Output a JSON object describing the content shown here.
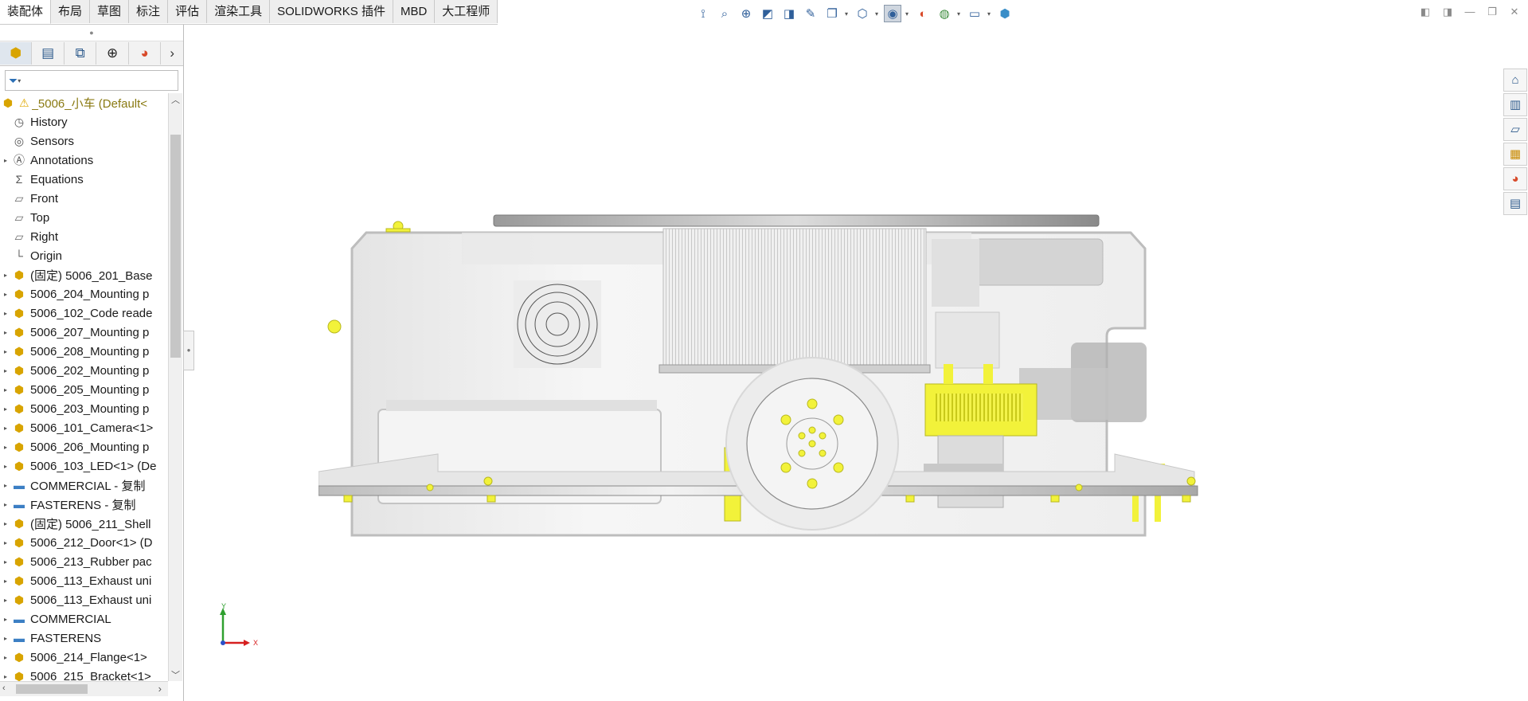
{
  "tabs": [
    {
      "label": "装配体",
      "active": true
    },
    {
      "label": "布局"
    },
    {
      "label": "草图"
    },
    {
      "label": "标注"
    },
    {
      "label": "评估"
    },
    {
      "label": "渲染工具"
    },
    {
      "label": "SOLIDWORKS 插件"
    },
    {
      "label": "MBD"
    },
    {
      "label": "大工程师"
    }
  ],
  "hud_icons": [
    "previous-view-icon",
    "zoom-to-fit-icon",
    "zoom-to-area-icon",
    "section-view-icon",
    "dynamic-annotation-icon",
    "view-orientation-icon",
    "display-style-icon",
    "hide-show-icon",
    "edit-appearance-icon",
    "apply-scene-icon",
    "view-settings-icon",
    "display-pane-icon"
  ],
  "tree": {
    "root_label": "_5006_小车  (Default<",
    "items": [
      {
        "label": "History",
        "icon": "history",
        "expandable": false
      },
      {
        "label": "Sensors",
        "icon": "sensor",
        "expandable": false
      },
      {
        "label": "Annotations",
        "icon": "annotation",
        "expandable": true
      },
      {
        "label": "Equations",
        "icon": "equation",
        "expandable": false
      },
      {
        "label": "Front",
        "icon": "plane",
        "expandable": false
      },
      {
        "label": "Top",
        "icon": "plane",
        "expandable": false
      },
      {
        "label": "Right",
        "icon": "plane",
        "expandable": false
      },
      {
        "label": "Origin",
        "icon": "origin",
        "expandable": false
      },
      {
        "label": "(固定) 5006_201_Base",
        "icon": "part",
        "expandable": true
      },
      {
        "label": "5006_204_Mounting p",
        "icon": "part",
        "expandable": true
      },
      {
        "label": "5006_102_Code reade",
        "icon": "part",
        "expandable": true
      },
      {
        "label": "5006_207_Mounting p",
        "icon": "part",
        "expandable": true
      },
      {
        "label": "5006_208_Mounting p",
        "icon": "part",
        "expandable": true
      },
      {
        "label": "5006_202_Mounting p",
        "icon": "part",
        "expandable": true
      },
      {
        "label": "5006_205_Mounting p",
        "icon": "part",
        "expandable": true
      },
      {
        "label": "5006_203_Mounting p",
        "icon": "part",
        "expandable": true
      },
      {
        "label": "5006_101_Camera<1>",
        "icon": "part",
        "expandable": true
      },
      {
        "label": "5006_206_Mounting p",
        "icon": "part",
        "expandable": true
      },
      {
        "label": "5006_103_LED<1> (De",
        "icon": "part",
        "expandable": true
      },
      {
        "label": "COMMERCIAL - 复制",
        "icon": "folder",
        "expandable": true
      },
      {
        "label": "FASTERENS - 复制",
        "icon": "folder",
        "expandable": true
      },
      {
        "label": "(固定) 5006_211_Shell",
        "icon": "part",
        "expandable": true
      },
      {
        "label": "5006_212_Door<1> (D",
        "icon": "part",
        "expandable": true
      },
      {
        "label": "5006_213_Rubber pac",
        "icon": "part",
        "expandable": true
      },
      {
        "label": "5006_113_Exhaust uni",
        "icon": "part",
        "expandable": true
      },
      {
        "label": "5006_113_Exhaust uni",
        "icon": "part",
        "expandable": true
      },
      {
        "label": "COMMERCIAL",
        "icon": "folder",
        "expandable": true
      },
      {
        "label": "FASTERENS",
        "icon": "folder",
        "expandable": true
      },
      {
        "label": "5006_214_Flange<1>",
        "icon": "part",
        "expandable": true
      },
      {
        "label": "5006_215_Bracket<1>",
        "icon": "part",
        "expandable": true
      }
    ]
  },
  "triad": {
    "y_label": "Y",
    "x_label": "X"
  },
  "task_pane_icons": [
    "home-icon",
    "resources-icon",
    "file-explorer-icon",
    "view-palette-icon",
    "appearances-icon",
    "custom-properties-icon"
  ],
  "colors": {
    "fastener_yellow": "#f2f23a",
    "tab_bg": "#eeeeee",
    "accent": "#2f5f9a"
  }
}
